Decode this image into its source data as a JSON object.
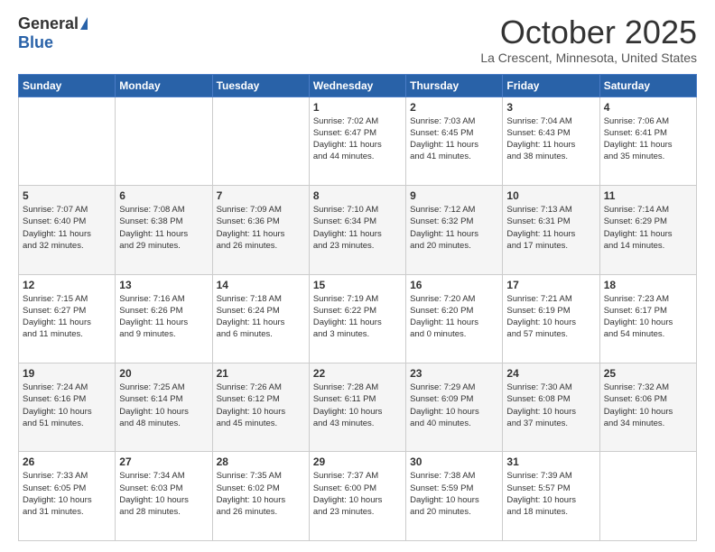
{
  "logo": {
    "general": "General",
    "blue": "Blue"
  },
  "header": {
    "month": "October 2025",
    "location": "La Crescent, Minnesota, United States"
  },
  "weekdays": [
    "Sunday",
    "Monday",
    "Tuesday",
    "Wednesday",
    "Thursday",
    "Friday",
    "Saturday"
  ],
  "rows": [
    [
      {
        "day": "",
        "info": ""
      },
      {
        "day": "",
        "info": ""
      },
      {
        "day": "",
        "info": ""
      },
      {
        "day": "1",
        "info": "Sunrise: 7:02 AM\nSunset: 6:47 PM\nDaylight: 11 hours\nand 44 minutes."
      },
      {
        "day": "2",
        "info": "Sunrise: 7:03 AM\nSunset: 6:45 PM\nDaylight: 11 hours\nand 41 minutes."
      },
      {
        "day": "3",
        "info": "Sunrise: 7:04 AM\nSunset: 6:43 PM\nDaylight: 11 hours\nand 38 minutes."
      },
      {
        "day": "4",
        "info": "Sunrise: 7:06 AM\nSunset: 6:41 PM\nDaylight: 11 hours\nand 35 minutes."
      }
    ],
    [
      {
        "day": "5",
        "info": "Sunrise: 7:07 AM\nSunset: 6:40 PM\nDaylight: 11 hours\nand 32 minutes."
      },
      {
        "day": "6",
        "info": "Sunrise: 7:08 AM\nSunset: 6:38 PM\nDaylight: 11 hours\nand 29 minutes."
      },
      {
        "day": "7",
        "info": "Sunrise: 7:09 AM\nSunset: 6:36 PM\nDaylight: 11 hours\nand 26 minutes."
      },
      {
        "day": "8",
        "info": "Sunrise: 7:10 AM\nSunset: 6:34 PM\nDaylight: 11 hours\nand 23 minutes."
      },
      {
        "day": "9",
        "info": "Sunrise: 7:12 AM\nSunset: 6:32 PM\nDaylight: 11 hours\nand 20 minutes."
      },
      {
        "day": "10",
        "info": "Sunrise: 7:13 AM\nSunset: 6:31 PM\nDaylight: 11 hours\nand 17 minutes."
      },
      {
        "day": "11",
        "info": "Sunrise: 7:14 AM\nSunset: 6:29 PM\nDaylight: 11 hours\nand 14 minutes."
      }
    ],
    [
      {
        "day": "12",
        "info": "Sunrise: 7:15 AM\nSunset: 6:27 PM\nDaylight: 11 hours\nand 11 minutes."
      },
      {
        "day": "13",
        "info": "Sunrise: 7:16 AM\nSunset: 6:26 PM\nDaylight: 11 hours\nand 9 minutes."
      },
      {
        "day": "14",
        "info": "Sunrise: 7:18 AM\nSunset: 6:24 PM\nDaylight: 11 hours\nand 6 minutes."
      },
      {
        "day": "15",
        "info": "Sunrise: 7:19 AM\nSunset: 6:22 PM\nDaylight: 11 hours\nand 3 minutes."
      },
      {
        "day": "16",
        "info": "Sunrise: 7:20 AM\nSunset: 6:20 PM\nDaylight: 11 hours\nand 0 minutes."
      },
      {
        "day": "17",
        "info": "Sunrise: 7:21 AM\nSunset: 6:19 PM\nDaylight: 10 hours\nand 57 minutes."
      },
      {
        "day": "18",
        "info": "Sunrise: 7:23 AM\nSunset: 6:17 PM\nDaylight: 10 hours\nand 54 minutes."
      }
    ],
    [
      {
        "day": "19",
        "info": "Sunrise: 7:24 AM\nSunset: 6:16 PM\nDaylight: 10 hours\nand 51 minutes."
      },
      {
        "day": "20",
        "info": "Sunrise: 7:25 AM\nSunset: 6:14 PM\nDaylight: 10 hours\nand 48 minutes."
      },
      {
        "day": "21",
        "info": "Sunrise: 7:26 AM\nSunset: 6:12 PM\nDaylight: 10 hours\nand 45 minutes."
      },
      {
        "day": "22",
        "info": "Sunrise: 7:28 AM\nSunset: 6:11 PM\nDaylight: 10 hours\nand 43 minutes."
      },
      {
        "day": "23",
        "info": "Sunrise: 7:29 AM\nSunset: 6:09 PM\nDaylight: 10 hours\nand 40 minutes."
      },
      {
        "day": "24",
        "info": "Sunrise: 7:30 AM\nSunset: 6:08 PM\nDaylight: 10 hours\nand 37 minutes."
      },
      {
        "day": "25",
        "info": "Sunrise: 7:32 AM\nSunset: 6:06 PM\nDaylight: 10 hours\nand 34 minutes."
      }
    ],
    [
      {
        "day": "26",
        "info": "Sunrise: 7:33 AM\nSunset: 6:05 PM\nDaylight: 10 hours\nand 31 minutes."
      },
      {
        "day": "27",
        "info": "Sunrise: 7:34 AM\nSunset: 6:03 PM\nDaylight: 10 hours\nand 28 minutes."
      },
      {
        "day": "28",
        "info": "Sunrise: 7:35 AM\nSunset: 6:02 PM\nDaylight: 10 hours\nand 26 minutes."
      },
      {
        "day": "29",
        "info": "Sunrise: 7:37 AM\nSunset: 6:00 PM\nDaylight: 10 hours\nand 23 minutes."
      },
      {
        "day": "30",
        "info": "Sunrise: 7:38 AM\nSunset: 5:59 PM\nDaylight: 10 hours\nand 20 minutes."
      },
      {
        "day": "31",
        "info": "Sunrise: 7:39 AM\nSunset: 5:57 PM\nDaylight: 10 hours\nand 18 minutes."
      },
      {
        "day": "",
        "info": ""
      }
    ]
  ]
}
